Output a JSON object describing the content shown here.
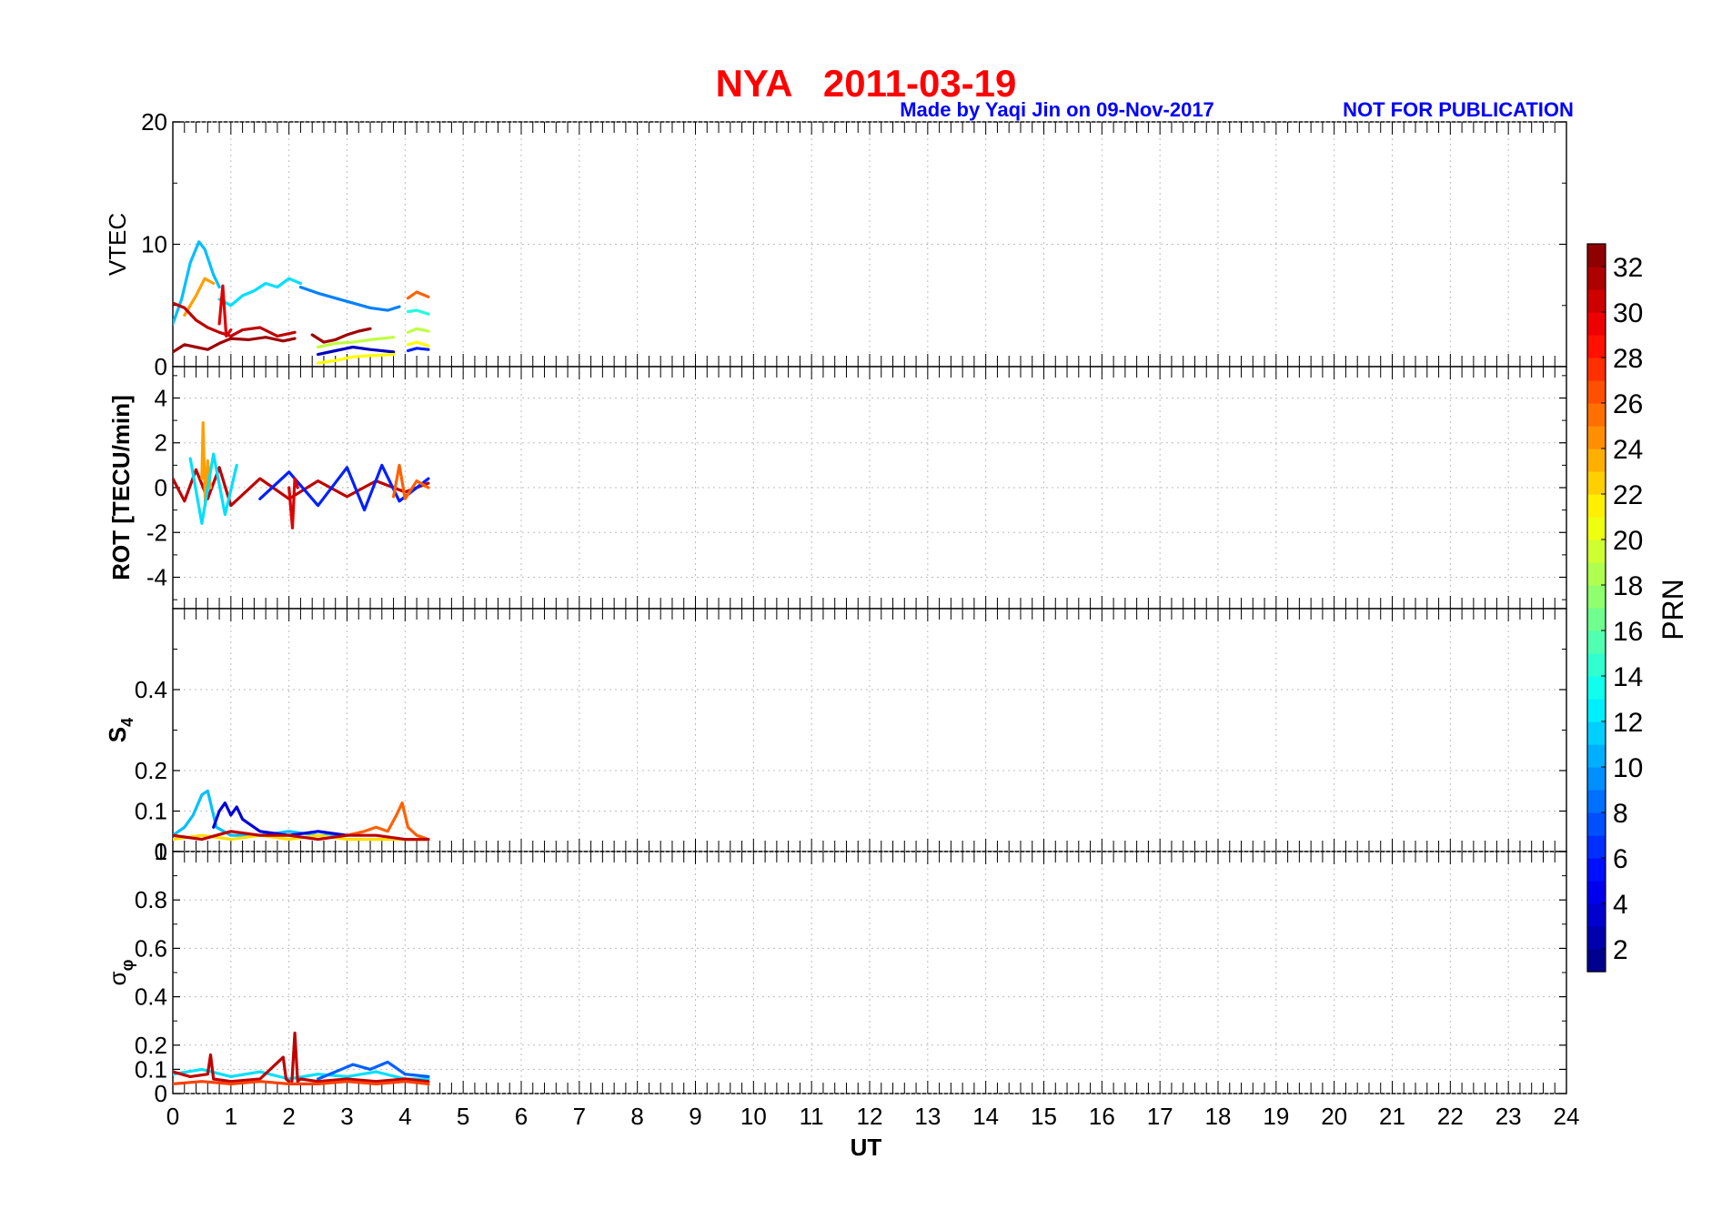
{
  "header": {
    "title": "NYA   2011-03-19",
    "credit": "Made by Yaqi Jin on 09-Nov-2017",
    "notice": "NOT FOR PUBLICATION"
  },
  "colors": {
    "title": "#ff0000",
    "credit": "#0000ff",
    "notice": "#0000ff",
    "grid": "#bdbdbd",
    "axis": "#000000",
    "background": "#ffffff"
  },
  "x_axis": {
    "label": "UT",
    "range": [
      0,
      24
    ],
    "ticks": [
      "0",
      "1",
      "2",
      "3",
      "4",
      "5",
      "6",
      "7",
      "8",
      "9",
      "10",
      "11",
      "12",
      "13",
      "14",
      "15",
      "16",
      "17",
      "18",
      "19",
      "20",
      "21",
      "22",
      "23",
      "24"
    ]
  },
  "colorbar": {
    "label": "PRN",
    "range": [
      1,
      33
    ],
    "colormap": "jet",
    "ticks": [
      "2",
      "4",
      "6",
      "8",
      "10",
      "12",
      "14",
      "16",
      "18",
      "20",
      "22",
      "24",
      "26",
      "28",
      "30",
      "32"
    ]
  },
  "chart_data": [
    {
      "type": "line",
      "ylabel": "VTEC",
      "ylim": [
        0,
        20
      ],
      "ytick_labels": [
        "0",
        "10",
        "20"
      ],
      "grid": true,
      "color_by": "PRN",
      "series": [
        {
          "prn": 11,
          "x": [
            0,
            0.15,
            0.3,
            0.45,
            0.55,
            0.7,
            0.8
          ],
          "y": [
            3.5,
            5.5,
            8.5,
            10.2,
            9.6,
            7.5,
            6.5
          ]
        },
        {
          "prn": 12,
          "x": [
            0.8,
            1.0,
            1.2,
            1.4,
            1.6,
            1.8,
            2.0,
            2.2
          ],
          "y": [
            5.5,
            5.0,
            5.8,
            6.2,
            6.8,
            6.5,
            7.2,
            6.8
          ]
        },
        {
          "prn": 9,
          "x": [
            2.2,
            2.5,
            2.8,
            3.1,
            3.4,
            3.7,
            3.9
          ],
          "y": [
            6.5,
            6.0,
            5.6,
            5.2,
            4.8,
            4.6,
            4.9
          ]
        },
        {
          "prn": 24,
          "x": [
            0.2,
            0.4,
            0.55,
            0.7
          ],
          "y": [
            4.2,
            5.8,
            7.2,
            6.8
          ]
        },
        {
          "prn": 26,
          "x": [
            4.05,
            4.2,
            4.4
          ],
          "y": [
            5.6,
            6.1,
            5.7
          ]
        },
        {
          "prn": 14,
          "x": [
            4.05,
            4.2,
            4.4
          ],
          "y": [
            4.5,
            4.6,
            4.3
          ]
        },
        {
          "prn": 19,
          "x": [
            4.05,
            4.2,
            4.4
          ],
          "y": [
            2.8,
            3.1,
            2.9
          ]
        },
        {
          "prn": 21,
          "x": [
            4.05,
            4.2,
            4.4
          ],
          "y": [
            1.8,
            2.0,
            1.7
          ]
        },
        {
          "prn": 6,
          "x": [
            4.05,
            4.2,
            4.4
          ],
          "y": [
            1.3,
            1.5,
            1.4
          ]
        },
        {
          "prn": 31,
          "x": [
            0,
            0.2,
            0.4,
            0.6,
            0.8,
            1.0,
            1.2,
            1.5,
            1.8,
            2.1
          ],
          "y": [
            5.2,
            4.8,
            3.8,
            3.2,
            2.8,
            2.5,
            3.0,
            3.2,
            2.5,
            2.8
          ]
        },
        {
          "prn": 32,
          "x": [
            0,
            0.2,
            0.4,
            0.6,
            0.8,
            1.0,
            1.3,
            1.6,
            1.9,
            2.1
          ],
          "y": [
            1.2,
            1.8,
            1.6,
            1.4,
            1.9,
            2.3,
            2.2,
            2.4,
            2.1,
            2.3
          ]
        },
        {
          "prn": 32,
          "x": [
            2.4,
            2.6,
            2.8,
            3.0,
            3.2,
            3.4
          ],
          "y": [
            2.6,
            2.0,
            2.2,
            2.6,
            2.9,
            3.1
          ]
        },
        {
          "prn": 30,
          "x": [
            0.8,
            0.86,
            0.92,
            1.0
          ],
          "y": [
            3.5,
            6.6,
            2.5,
            3.0
          ]
        },
        {
          "prn": 3,
          "x": [
            2.5,
            2.8,
            3.1,
            3.4,
            3.8
          ],
          "y": [
            1.0,
            1.3,
            1.6,
            1.4,
            1.2
          ]
        },
        {
          "prn": 19,
          "x": [
            2.5,
            2.8,
            3.1,
            3.4,
            3.8
          ],
          "y": [
            1.6,
            1.9,
            2.0,
            2.2,
            2.4
          ]
        },
        {
          "prn": 21,
          "x": [
            2.5,
            2.8,
            3.1,
            3.4,
            3.8
          ],
          "y": [
            0.3,
            0.5,
            0.8,
            0.9,
            1.0
          ]
        }
      ]
    },
    {
      "type": "line",
      "ylabel": "ROT [TECU/min]",
      "ylim": [
        -5.4,
        5.4
      ],
      "ytick_labels": [
        "-4",
        "-2",
        "0",
        "2",
        "4"
      ],
      "grid": true,
      "color_by": "PRN",
      "series": [
        {
          "prn": 31,
          "x": [
            0,
            0.2,
            0.4,
            0.6,
            0.8,
            1.0,
            1.5,
            2.0,
            2.5,
            3.0,
            3.5,
            4.0,
            4.4
          ],
          "y": [
            0.4,
            -0.6,
            0.8,
            -0.5,
            0.9,
            -0.8,
            0.4,
            -0.5,
            0.3,
            -0.4,
            0.3,
            -0.2,
            0.2
          ]
        },
        {
          "prn": 24,
          "x": [
            0.5,
            0.52,
            0.56,
            0.6,
            0.65
          ],
          "y": [
            0.4,
            2.9,
            -0.8,
            1.2,
            0.0
          ]
        },
        {
          "prn": 12,
          "x": [
            0.3,
            0.5,
            0.7,
            0.9,
            1.1
          ],
          "y": [
            1.3,
            -1.6,
            1.5,
            -1.2,
            1.0
          ]
        },
        {
          "prn": 6,
          "x": [
            1.5,
            2.0,
            2.5,
            3.0,
            3.3,
            3.6,
            3.9,
            4.4
          ],
          "y": [
            -0.5,
            0.7,
            -0.8,
            0.9,
            -1.0,
            1.0,
            -0.6,
            0.4
          ]
        },
        {
          "prn": 30,
          "x": [
            2.0,
            2.06,
            2.1,
            2.15
          ],
          "y": [
            0.0,
            -1.8,
            0.4,
            0.0
          ]
        },
        {
          "prn": 26,
          "x": [
            3.8,
            3.9,
            4.0,
            4.2,
            4.4
          ],
          "y": [
            -0.4,
            1.0,
            -0.5,
            0.3,
            0.0
          ]
        }
      ]
    },
    {
      "type": "line",
      "ylabel": "S4",
      "ylim": [
        0,
        0.6
      ],
      "ytick_labels": [
        "0",
        "0.1",
        "0.2",
        "0.4"
      ],
      "grid": true,
      "color_by": "PRN",
      "series": [
        {
          "prn": 11,
          "x": [
            0,
            0.2,
            0.35,
            0.5,
            0.6,
            0.75,
            1.0,
            1.5,
            2.0,
            2.5,
            3.0
          ],
          "y": [
            0.04,
            0.06,
            0.09,
            0.14,
            0.15,
            0.06,
            0.04,
            0.04,
            0.05,
            0.04,
            0.04
          ]
        },
        {
          "prn": 4,
          "x": [
            0.7,
            0.8,
            0.9,
            1.0,
            1.1,
            1.2,
            1.3,
            1.5,
            2.0,
            2.5,
            3.0
          ],
          "y": [
            0.06,
            0.1,
            0.12,
            0.09,
            0.11,
            0.08,
            0.07,
            0.05,
            0.04,
            0.05,
            0.04
          ]
        },
        {
          "prn": 26,
          "x": [
            3.0,
            3.3,
            3.5,
            3.7,
            3.85,
            3.95,
            4.05,
            4.2,
            4.4
          ],
          "y": [
            0.04,
            0.05,
            0.06,
            0.05,
            0.09,
            0.12,
            0.06,
            0.04,
            0.03
          ]
        },
        {
          "prn": 22,
          "x": [
            0,
            0.5,
            1.0,
            1.5,
            2.0,
            2.5,
            3.0,
            3.5,
            4.0,
            4.4
          ],
          "y": [
            0.03,
            0.04,
            0.03,
            0.04,
            0.03,
            0.04,
            0.03,
            0.03,
            0.03,
            0.03
          ]
        },
        {
          "prn": 31,
          "x": [
            0,
            0.5,
            1.0,
            1.5,
            2.0,
            2.5,
            3.0,
            3.5,
            4.0,
            4.4
          ],
          "y": [
            0.04,
            0.03,
            0.05,
            0.04,
            0.04,
            0.03,
            0.04,
            0.04,
            0.03,
            0.03
          ]
        }
      ]
    },
    {
      "type": "line",
      "ylabel": "σφ",
      "ylim": [
        0,
        1
      ],
      "ytick_labels": [
        "0",
        "0.1",
        "0.2",
        "0.4",
        "0.6",
        "0.8",
        "1"
      ],
      "grid": true,
      "color_by": "PRN",
      "series": [
        {
          "prn": 12,
          "x": [
            0,
            0.5,
            1.0,
            1.5,
            2.0,
            2.5,
            3.0,
            3.5,
            4.0,
            4.4
          ],
          "y": [
            0.08,
            0.1,
            0.07,
            0.09,
            0.06,
            0.08,
            0.07,
            0.09,
            0.06,
            0.06
          ]
        },
        {
          "prn": 8,
          "x": [
            2.5,
            2.8,
            3.1,
            3.4,
            3.7,
            4.0,
            4.4
          ],
          "y": [
            0.06,
            0.09,
            0.12,
            0.1,
            0.13,
            0.08,
            0.07
          ]
        },
        {
          "prn": 31,
          "x": [
            0,
            0.3,
            0.6,
            0.65,
            0.7,
            1.0,
            1.5,
            1.9,
            1.95,
            2.0
          ],
          "y": [
            0.09,
            0.07,
            0.08,
            0.16,
            0.06,
            0.05,
            0.06,
            0.15,
            0.06,
            0.05
          ]
        },
        {
          "prn": 31,
          "x": [
            2.05,
            2.1,
            2.15,
            2.2,
            2.5,
            3.0,
            3.5,
            4.0,
            4.4
          ],
          "y": [
            0.05,
            0.25,
            0.05,
            0.06,
            0.05,
            0.06,
            0.05,
            0.06,
            0.05
          ]
        },
        {
          "prn": 27,
          "x": [
            0,
            0.5,
            1.0,
            1.5,
            2.0,
            2.5,
            3.0,
            3.5,
            4.0,
            4.4
          ],
          "y": [
            0.04,
            0.05,
            0.04,
            0.05,
            0.04,
            0.04,
            0.05,
            0.04,
            0.05,
            0.04
          ]
        }
      ]
    }
  ]
}
